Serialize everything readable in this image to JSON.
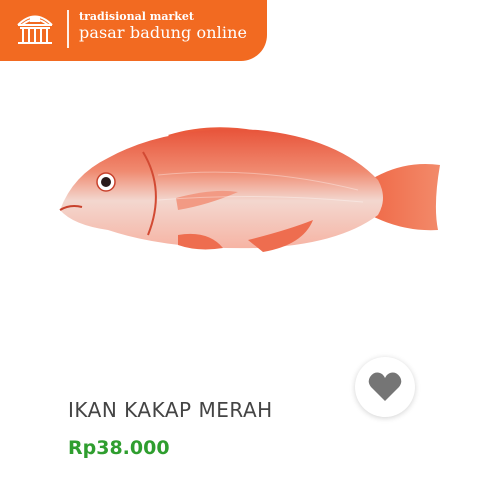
{
  "header": {
    "tagline": "tradisional market",
    "brand": "pasar badung online",
    "logo_icon": "market-building-icon",
    "background_color": "#f26a21"
  },
  "product": {
    "name": "IKAN KAKAP MERAH",
    "price": "Rp38.000",
    "price_color": "#2f9e2f",
    "image": "red-snapper-fish-image",
    "favorite_icon": "heart-icon"
  }
}
